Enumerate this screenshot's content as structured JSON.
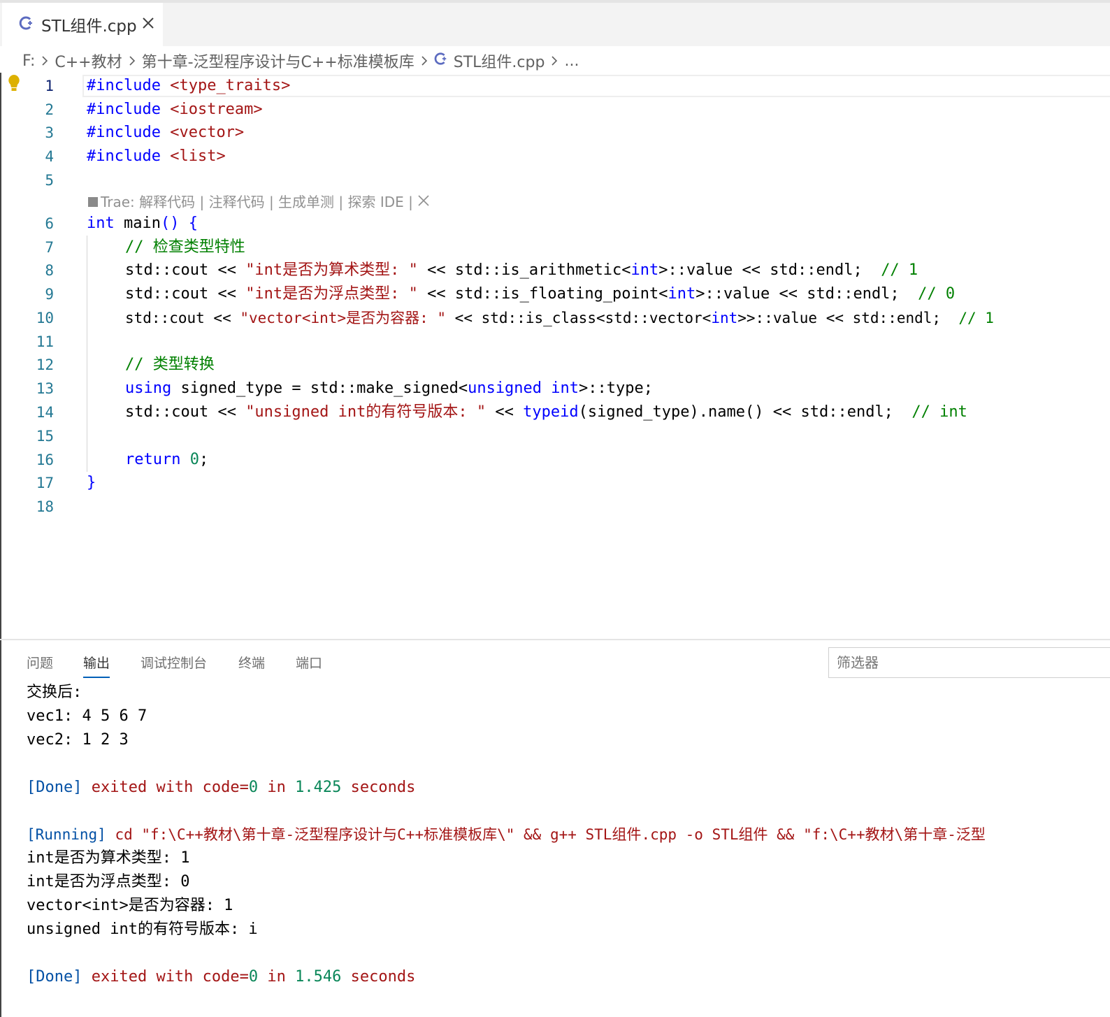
{
  "tab": {
    "label": "STL组件.cpp",
    "icon": "cpp-file-icon"
  },
  "breadcrumb": {
    "items": [
      "F:",
      "C++教材",
      "第十章-泛型程序设计与C++标准模板库",
      "STL组件.cpp",
      "..."
    ]
  },
  "editor": {
    "line_numbers": [
      "1",
      "2",
      "3",
      "4",
      "5",
      "6",
      "7",
      "8",
      "9",
      "10",
      "11",
      "12",
      "13",
      "14",
      "15",
      "16",
      "17",
      "18"
    ],
    "codelens": "Trae: 解释代码 | 注释代码 | 生成单测 | 探索 IDE |",
    "code": {
      "l1_kw": "#include",
      "l1_str": " <type_traits>",
      "l2_kw": "#include",
      "l2_str": " <iostream>",
      "l3_kw": "#include",
      "l3_str": " <vector>",
      "l4_kw": "#include",
      "l4_str": " <list>",
      "l6_kw": "int",
      "l6_a": " main",
      "l6_b": "() {",
      "l7_cmt": "// 检查类型特性",
      "l8_a": "std::cout << ",
      "l8_str": "\"int是否为算术类型: \"",
      "l8_b": " << std::is_arithmetic<",
      "l8_t": "int",
      "l8_c": ">::value << std::endl;  ",
      "l8_cmt": "// 1",
      "l9_a": "std::cout << ",
      "l9_str": "\"int是否为浮点类型: \"",
      "l9_b": " << std::is_floating_point<",
      "l9_t": "int",
      "l9_c": ">::value << std::endl;  ",
      "l9_cmt": "// 0",
      "l10_a": "std::cout << ",
      "l10_str": "\"vector<int>是否为容器: \"",
      "l10_b": " << std::is_class<std::vector<",
      "l10_t": "int",
      "l10_c": ">>::value << std::endl;  ",
      "l10_cmt": "// 1",
      "l12_cmt": "// 类型转换",
      "l13_kw": "using",
      "l13_a": " signed_type = std::make_signed<",
      "l13_t1": "unsigned",
      "l13_sp": " ",
      "l13_t2": "int",
      "l13_b": ">::type;",
      "l14_a": "std::cout << ",
      "l14_str": "\"unsigned int的有符号版本: \"",
      "l14_b": " << ",
      "l14_kw": "typeid",
      "l14_c": "(signed_type).name() << std::endl;  ",
      "l14_cmt": "// int",
      "l16_kw": "return",
      "l16_sp": " ",
      "l16_num": "0",
      "l16_b": ";",
      "l17": "}"
    }
  },
  "panel": {
    "tabs": [
      "问题",
      "输出",
      "调试控制台",
      "终端",
      "端口"
    ],
    "active_tab": "输出",
    "filter_placeholder": "筛选器",
    "output": {
      "o1": "交换后:",
      "o2": "vec1: 4 5 6 7",
      "o3": "vec2: 1 2 3",
      "o5_tag": "[Done]",
      "o5_a": " exited with code=",
      "o5_code": "0",
      "o5_b": " in ",
      "o5_time": "1.425",
      "o5_c": " seconds",
      "o7_tag": "[Running]",
      "o7_cmd": " cd \"f:\\C++教材\\第十章-泛型程序设计与C++标准模板库\\\" && g++ STL组件.cpp -o STL组件 && \"f:\\C++教材\\第十章-泛型",
      "o8": "int是否为算术类型: 1",
      "o9": "int是否为浮点类型: 0",
      "o10": "vector<int>是否为容器: 1",
      "o11": "unsigned int的有符号版本: i",
      "o13_tag": "[Done]",
      "o13_a": " exited with code=",
      "o13_code": "0",
      "o13_b": " in ",
      "o13_time": "1.546",
      "o13_c": " seconds"
    }
  },
  "colors": {
    "keyword": "#0000ff",
    "string": "#a31515",
    "comment": "#008000",
    "number": "#098658",
    "line_number": "#237893",
    "accent": "#005fb8"
  }
}
